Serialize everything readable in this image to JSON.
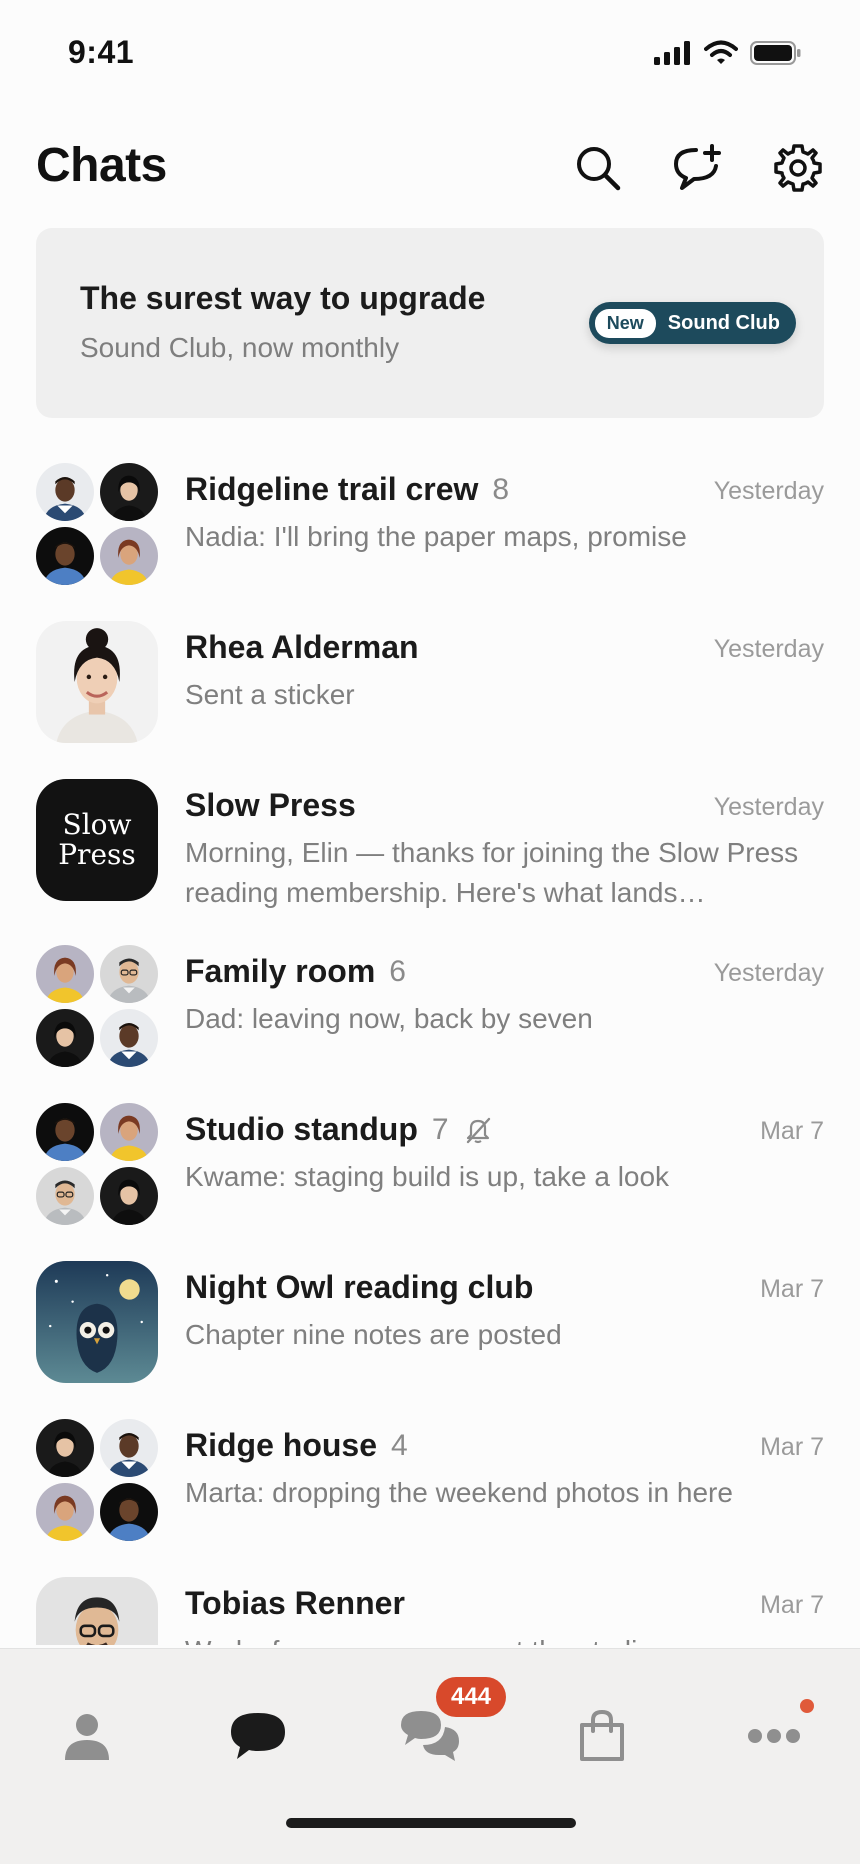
{
  "status_bar": {
    "time": "9:41"
  },
  "header": {
    "title": "Chats"
  },
  "promo": {
    "title": "The surest way to upgrade",
    "subtitle": "Sound Club, now monthly",
    "pill_new": "New",
    "pill_label": "Sound Club"
  },
  "chats": [
    {
      "name": "Ridgeline trail crew",
      "count": "8",
      "time": "Yesterday",
      "preview": "Nadia: I'll bring the paper maps, promise",
      "avatar": "group"
    },
    {
      "name": "Rhea Alderman",
      "count": "",
      "time": "Yesterday",
      "preview": "Sent a sticker",
      "avatar": "person-woman"
    },
    {
      "name": "Slow Press",
      "count": "",
      "time": "Yesterday",
      "preview": "Morning, Elin — thanks for joining the Slow Press reading membership. Here's what lands…",
      "avatar": "logo",
      "logo_line1": "Slow",
      "logo_line2": "Press"
    },
    {
      "name": "Family room",
      "count": "6",
      "time": "Yesterday",
      "preview": "Dad: leaving now, back by seven",
      "avatar": "group"
    },
    {
      "name": "Studio standup",
      "count": "7",
      "time": "Mar 7",
      "preview": "Kwame: staging build is up, take a look",
      "avatar": "group",
      "muted": true
    },
    {
      "name": "Night Owl reading club",
      "count": "",
      "time": "Mar 7",
      "preview": "Chapter nine notes are posted",
      "avatar": "owl"
    },
    {
      "name": "Ridge house",
      "count": "4",
      "time": "Mar 7",
      "preview": "Marta: dropping the weekend photos in here",
      "avatar": "group"
    },
    {
      "name": "Tobias Renner",
      "count": "",
      "time": "Mar 7",
      "preview": "Works for me — see you at the studio",
      "avatar": "person-man"
    }
  ],
  "tab_bar": {
    "chats_badge": "444",
    "tabs": [
      "profile-icon",
      "chat-bubble-icon",
      "group-chats-icon",
      "shopping-bag-icon",
      "more-icon"
    ]
  },
  "colors": {
    "accent": "#1d4a5c",
    "badge": "#d8492b",
    "text_secondary": "#7f7f7f"
  }
}
